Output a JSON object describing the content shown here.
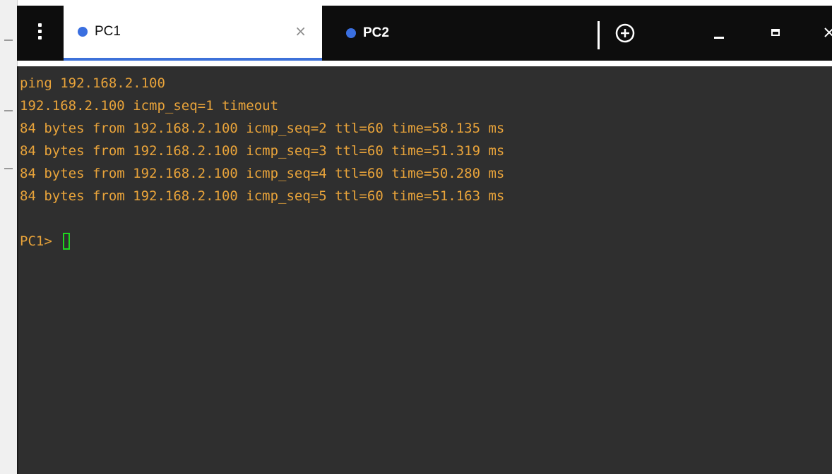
{
  "tabs": [
    {
      "label": "PC1",
      "active": true,
      "closable": true
    },
    {
      "label": "PC2",
      "active": false,
      "closable": false
    }
  ],
  "icons": {
    "menu": "vertical-ellipsis",
    "close_tab": "×",
    "new_tab": "plus-circle",
    "minimize": "minimize",
    "maximize": "maximize"
  },
  "terminal": {
    "lines": [
      "ping 192.168.2.100",
      "192.168.2.100 icmp_seq=1 timeout",
      "84 bytes from 192.168.2.100 icmp_seq=2 ttl=60 time=58.135 ms",
      "84 bytes from 192.168.2.100 icmp_seq=3 ttl=60 time=51.319 ms",
      "84 bytes from 192.168.2.100 icmp_seq=4 ttl=60 time=50.280 ms",
      "84 bytes from 192.168.2.100 icmp_seq=5 ttl=60 time=51.163 ms"
    ],
    "prompt": "PC1> "
  },
  "colors": {
    "tabbar_bg": "#0d0d0d",
    "active_tab_underline": "#3d71d9",
    "tab_dot": "#3a6fe0",
    "terminal_bg": "#2f2f2f",
    "terminal_text": "#e8a33a",
    "cursor": "#1fd61f"
  }
}
